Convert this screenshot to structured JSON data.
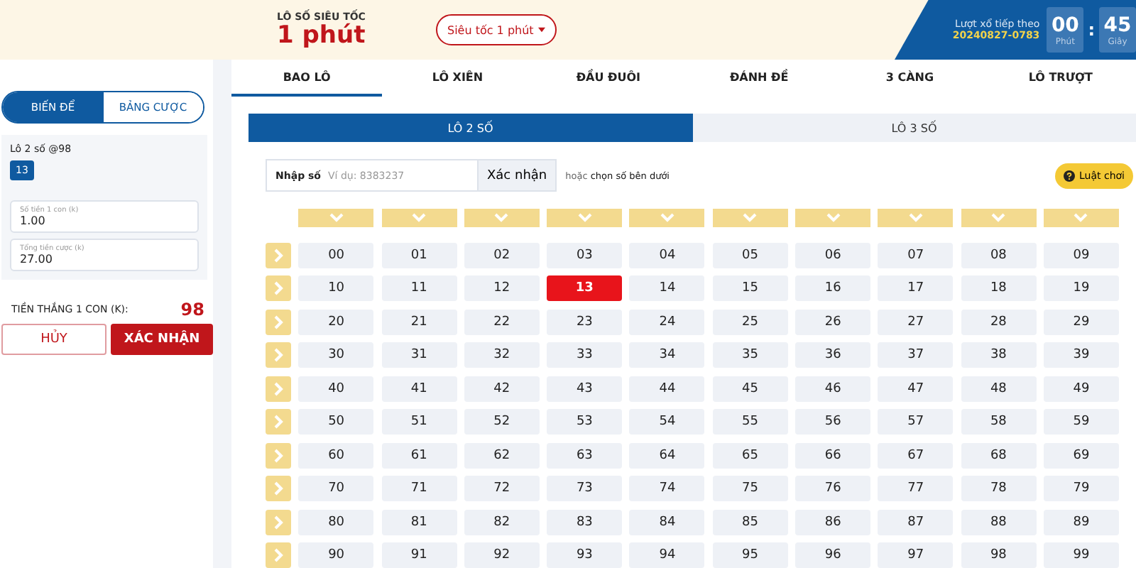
{
  "header": {
    "subtitle": "LÔ SỐ SIÊU TỐC",
    "title": "1 phút",
    "mode_dropdown": "Siêu tốc 1 phút",
    "next_draw_label": "Lượt xổ tiếp theo",
    "next_draw_id": "20240827-0783",
    "timer": [
      {
        "value": "00",
        "unit": "Phút"
      },
      {
        "value": "45",
        "unit": "Giây"
      }
    ],
    "timer_separator": ":"
  },
  "bet_panel": {
    "tabs": [
      {
        "label": "BIẾN ĐỂ",
        "selected": true
      },
      {
        "label": "BẢNG CƯỢC",
        "selected": false
      }
    ],
    "bet_type": "Lô 2 số @98",
    "chosen_numbers": [
      "13"
    ],
    "fields": [
      {
        "label": "Số tiền 1 con (k)",
        "value": "1.00"
      },
      {
        "label": "Tổng tiền cược (k)",
        "value": "27.00"
      }
    ],
    "win_label": "TIỀN THẮNG 1 CON (K):",
    "win_value": "98",
    "buttons": [
      {
        "kind": "cancel",
        "label": "HỦY"
      },
      {
        "kind": "confirm",
        "label": "XÁC NHẬN"
      }
    ]
  },
  "game_tabs": [
    {
      "label": "BAO LÔ",
      "selected": true
    },
    {
      "label": "LÔ XIÊN",
      "selected": false
    },
    {
      "label": "ĐẦU ĐUÔI",
      "selected": false
    },
    {
      "label": "ĐÁNH ĐỀ",
      "selected": false
    },
    {
      "label": "3 CÀNG",
      "selected": false
    },
    {
      "label": "LÔ TRƯỢT",
      "selected": false
    }
  ],
  "sub_tabs": [
    {
      "label": "LÔ 2 SỐ",
      "selected": true
    },
    {
      "label": "LÔ 3 SỐ",
      "selected": false
    }
  ],
  "entry": {
    "label": "Nhập số",
    "placeholder": "Ví dụ: 8383237",
    "button": "Xác nhận",
    "hint_prefix": "hoặc",
    "hint": "chọn số bên dưới",
    "rules_button": "Luật chơi"
  },
  "number_grid": [
    [
      {
        "label": "00",
        "selected": false
      },
      {
        "label": "01",
        "selected": false
      },
      {
        "label": "02",
        "selected": false
      },
      {
        "label": "03",
        "selected": false
      },
      {
        "label": "04",
        "selected": false
      },
      {
        "label": "05",
        "selected": false
      },
      {
        "label": "06",
        "selected": false
      },
      {
        "label": "07",
        "selected": false
      },
      {
        "label": "08",
        "selected": false
      },
      {
        "label": "09",
        "selected": false
      }
    ],
    [
      {
        "label": "10",
        "selected": false
      },
      {
        "label": "11",
        "selected": false
      },
      {
        "label": "12",
        "selected": false
      },
      {
        "label": "13",
        "selected": true
      },
      {
        "label": "14",
        "selected": false
      },
      {
        "label": "15",
        "selected": false
      },
      {
        "label": "16",
        "selected": false
      },
      {
        "label": "17",
        "selected": false
      },
      {
        "label": "18",
        "selected": false
      },
      {
        "label": "19",
        "selected": false
      }
    ],
    [
      {
        "label": "20",
        "selected": false
      },
      {
        "label": "21",
        "selected": false
      },
      {
        "label": "22",
        "selected": false
      },
      {
        "label": "23",
        "selected": false
      },
      {
        "label": "24",
        "selected": false
      },
      {
        "label": "25",
        "selected": false
      },
      {
        "label": "26",
        "selected": false
      },
      {
        "label": "27",
        "selected": false
      },
      {
        "label": "28",
        "selected": false
      },
      {
        "label": "29",
        "selected": false
      }
    ],
    [
      {
        "label": "30",
        "selected": false
      },
      {
        "label": "31",
        "selected": false
      },
      {
        "label": "32",
        "selected": false
      },
      {
        "label": "33",
        "selected": false
      },
      {
        "label": "34",
        "selected": false
      },
      {
        "label": "35",
        "selected": false
      },
      {
        "label": "36",
        "selected": false
      },
      {
        "label": "37",
        "selected": false
      },
      {
        "label": "38",
        "selected": false
      },
      {
        "label": "39",
        "selected": false
      }
    ],
    [
      {
        "label": "40",
        "selected": false
      },
      {
        "label": "41",
        "selected": false
      },
      {
        "label": "42",
        "selected": false
      },
      {
        "label": "43",
        "selected": false
      },
      {
        "label": "44",
        "selected": false
      },
      {
        "label": "45",
        "selected": false
      },
      {
        "label": "46",
        "selected": false
      },
      {
        "label": "47",
        "selected": false
      },
      {
        "label": "48",
        "selected": false
      },
      {
        "label": "49",
        "selected": false
      }
    ],
    [
      {
        "label": "50",
        "selected": false
      },
      {
        "label": "51",
        "selected": false
      },
      {
        "label": "52",
        "selected": false
      },
      {
        "label": "53",
        "selected": false
      },
      {
        "label": "54",
        "selected": false
      },
      {
        "label": "55",
        "selected": false
      },
      {
        "label": "56",
        "selected": false
      },
      {
        "label": "57",
        "selected": false
      },
      {
        "label": "58",
        "selected": false
      },
      {
        "label": "59",
        "selected": false
      }
    ],
    [
      {
        "label": "60",
        "selected": false
      },
      {
        "label": "61",
        "selected": false
      },
      {
        "label": "62",
        "selected": false
      },
      {
        "label": "63",
        "selected": false
      },
      {
        "label": "64",
        "selected": false
      },
      {
        "label": "65",
        "selected": false
      },
      {
        "label": "66",
        "selected": false
      },
      {
        "label": "67",
        "selected": false
      },
      {
        "label": "68",
        "selected": false
      },
      {
        "label": "69",
        "selected": false
      }
    ],
    [
      {
        "label": "70",
        "selected": false
      },
      {
        "label": "71",
        "selected": false
      },
      {
        "label": "72",
        "selected": false
      },
      {
        "label": "73",
        "selected": false
      },
      {
        "label": "74",
        "selected": false
      },
      {
        "label": "75",
        "selected": false
      },
      {
        "label": "76",
        "selected": false
      },
      {
        "label": "77",
        "selected": false
      },
      {
        "label": "78",
        "selected": false
      },
      {
        "label": "79",
        "selected": false
      }
    ],
    [
      {
        "label": "80",
        "selected": false
      },
      {
        "label": "81",
        "selected": false
      },
      {
        "label": "82",
        "selected": false
      },
      {
        "label": "83",
        "selected": false
      },
      {
        "label": "84",
        "selected": false
      },
      {
        "label": "85",
        "selected": false
      },
      {
        "label": "86",
        "selected": false
      },
      {
        "label": "87",
        "selected": false
      },
      {
        "label": "88",
        "selected": false
      },
      {
        "label": "89",
        "selected": false
      }
    ],
    [
      {
        "label": "90",
        "selected": false
      },
      {
        "label": "91",
        "selected": false
      },
      {
        "label": "92",
        "selected": false
      },
      {
        "label": "93",
        "selected": false
      },
      {
        "label": "94",
        "selected": false
      },
      {
        "label": "95",
        "selected": false
      },
      {
        "label": "96",
        "selected": false
      },
      {
        "label": "97",
        "selected": false
      },
      {
        "label": "98",
        "selected": false
      },
      {
        "label": "99",
        "selected": false
      }
    ]
  ]
}
